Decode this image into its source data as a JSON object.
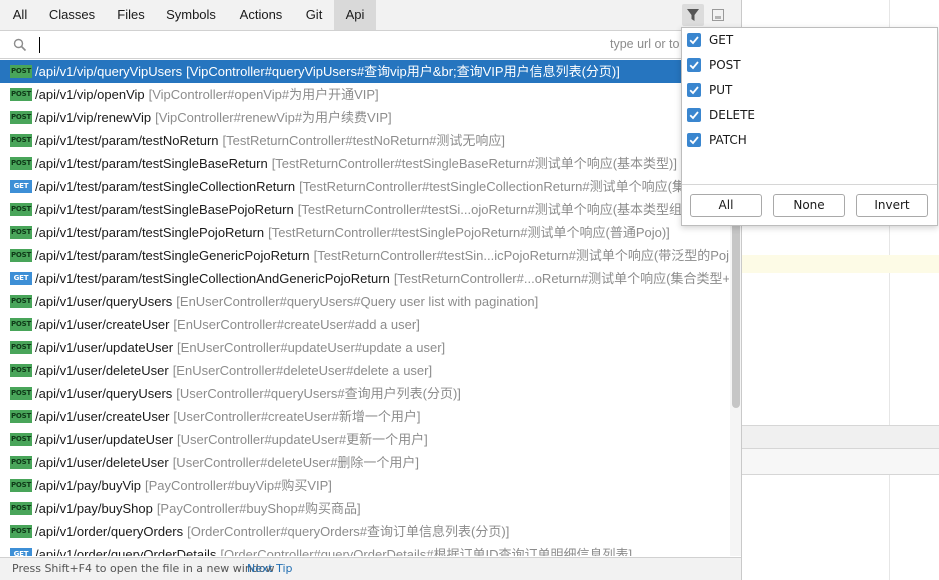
{
  "tabs": [
    "All",
    "Classes",
    "Files",
    "Symbols",
    "Actions",
    "Git",
    "Api"
  ],
  "selected_tab": "Api",
  "search": {
    "value": "",
    "hint": "type url or to"
  },
  "rows": [
    {
      "method": "POST",
      "path": "/api/v1/vip/queryVipUsers",
      "desc": "[VipController#queryVipUsers#查询vip用户&br;查询VIP用户信息列表(分页)]"
    },
    {
      "method": "POST",
      "path": "/api/v1/vip/openVip",
      "desc": "[VipController#openVip#为用户开通VIP]"
    },
    {
      "method": "POST",
      "path": "/api/v1/vip/renewVip",
      "desc": "[VipController#renewVip#为用户续费VIP]"
    },
    {
      "method": "POST",
      "path": "/api/v1/test/param/testNoReturn",
      "desc": "[TestReturnController#testNoReturn#测试无响应]"
    },
    {
      "method": "POST",
      "path": "/api/v1/test/param/testSingleBaseReturn",
      "desc": "[TestReturnController#testSingleBaseReturn#测试单个响应(基本类型)]"
    },
    {
      "method": "GET",
      "path": "/api/v1/test/param/testSingleCollectionReturn",
      "desc": "[TestReturnController#testSingleCollectionReturn#测试单个响应(集"
    },
    {
      "method": "POST",
      "path": "/api/v1/test/param/testSingleBasePojoReturn",
      "desc": "[TestReturnController#testSi...ojoReturn#测试单个响应(基本类型组合"
    },
    {
      "method": "POST",
      "path": "/api/v1/test/param/testSinglePojoReturn",
      "desc": "[TestReturnController#testSinglePojoReturn#测试单个响应(普通Pojo)]"
    },
    {
      "method": "POST",
      "path": "/api/v1/test/param/testSingleGenericPojoReturn",
      "desc": "[TestReturnController#testSin...icPojoReturn#测试单个响应(带泛型的Pojo)]"
    },
    {
      "method": "GET",
      "path": "/api/v1/test/param/testSingleCollectionAndGenericPojoReturn",
      "desc": "[TestReturnController#...oReturn#测试单个响应(集合类型+泛"
    },
    {
      "method": "POST",
      "path": "/api/v1/user/queryUsers",
      "desc": "[EnUserController#queryUsers#Query user list with pagination]"
    },
    {
      "method": "POST",
      "path": "/api/v1/user/createUser",
      "desc": "[EnUserController#createUser#add a user]"
    },
    {
      "method": "POST",
      "path": "/api/v1/user/updateUser",
      "desc": "[EnUserController#updateUser#update a user]"
    },
    {
      "method": "POST",
      "path": "/api/v1/user/deleteUser",
      "desc": "[EnUserController#deleteUser#delete a user]"
    },
    {
      "method": "POST",
      "path": "/api/v1/user/queryUsers",
      "desc": "[UserController#queryUsers#查询用户列表(分页)]"
    },
    {
      "method": "POST",
      "path": "/api/v1/user/createUser",
      "desc": "[UserController#createUser#新增一个用户]"
    },
    {
      "method": "POST",
      "path": "/api/v1/user/updateUser",
      "desc": "[UserController#updateUser#更新一个用户]"
    },
    {
      "method": "POST",
      "path": "/api/v1/user/deleteUser",
      "desc": "[UserController#deleteUser#删除一个用户]"
    },
    {
      "method": "POST",
      "path": "/api/v1/pay/buyVip",
      "desc": "[PayController#buyVip#购买VIP]"
    },
    {
      "method": "POST",
      "path": "/api/v1/pay/buyShop",
      "desc": "[PayController#buyShop#购买商品]"
    },
    {
      "method": "POST",
      "path": "/api/v1/order/queryOrders",
      "desc": "[OrderController#queryOrders#查询订单信息列表(分页)]"
    },
    {
      "method": "GET",
      "path": "/api/v1/order/queryOrderDetails",
      "desc": "[OrderController#queryOrderDetails#根据订单ID查询订单明细信息列表]"
    }
  ],
  "selected_row": 0,
  "filter": {
    "options": [
      {
        "label": "GET",
        "checked": true
      },
      {
        "label": "POST",
        "checked": true
      },
      {
        "label": "PUT",
        "checked": true
      },
      {
        "label": "DELETE",
        "checked": true
      },
      {
        "label": "PATCH",
        "checked": true
      }
    ],
    "buttons": {
      "all": "All",
      "none": "None",
      "invert": "Invert"
    }
  },
  "status": {
    "tip": "Press Shift+F4 to open the file in a new window",
    "next_tip": "Next Tip"
  },
  "colors": {
    "selection": "#2675bf",
    "post_badge": "#49a55a",
    "get_badge": "#3d8fd6",
    "checkbox": "#3a86cf",
    "link": "#2470b3"
  },
  "icons": {
    "search": "search-icon",
    "filter": "filter-icon",
    "pin": "pin-icon",
    "check": "check-icon"
  }
}
